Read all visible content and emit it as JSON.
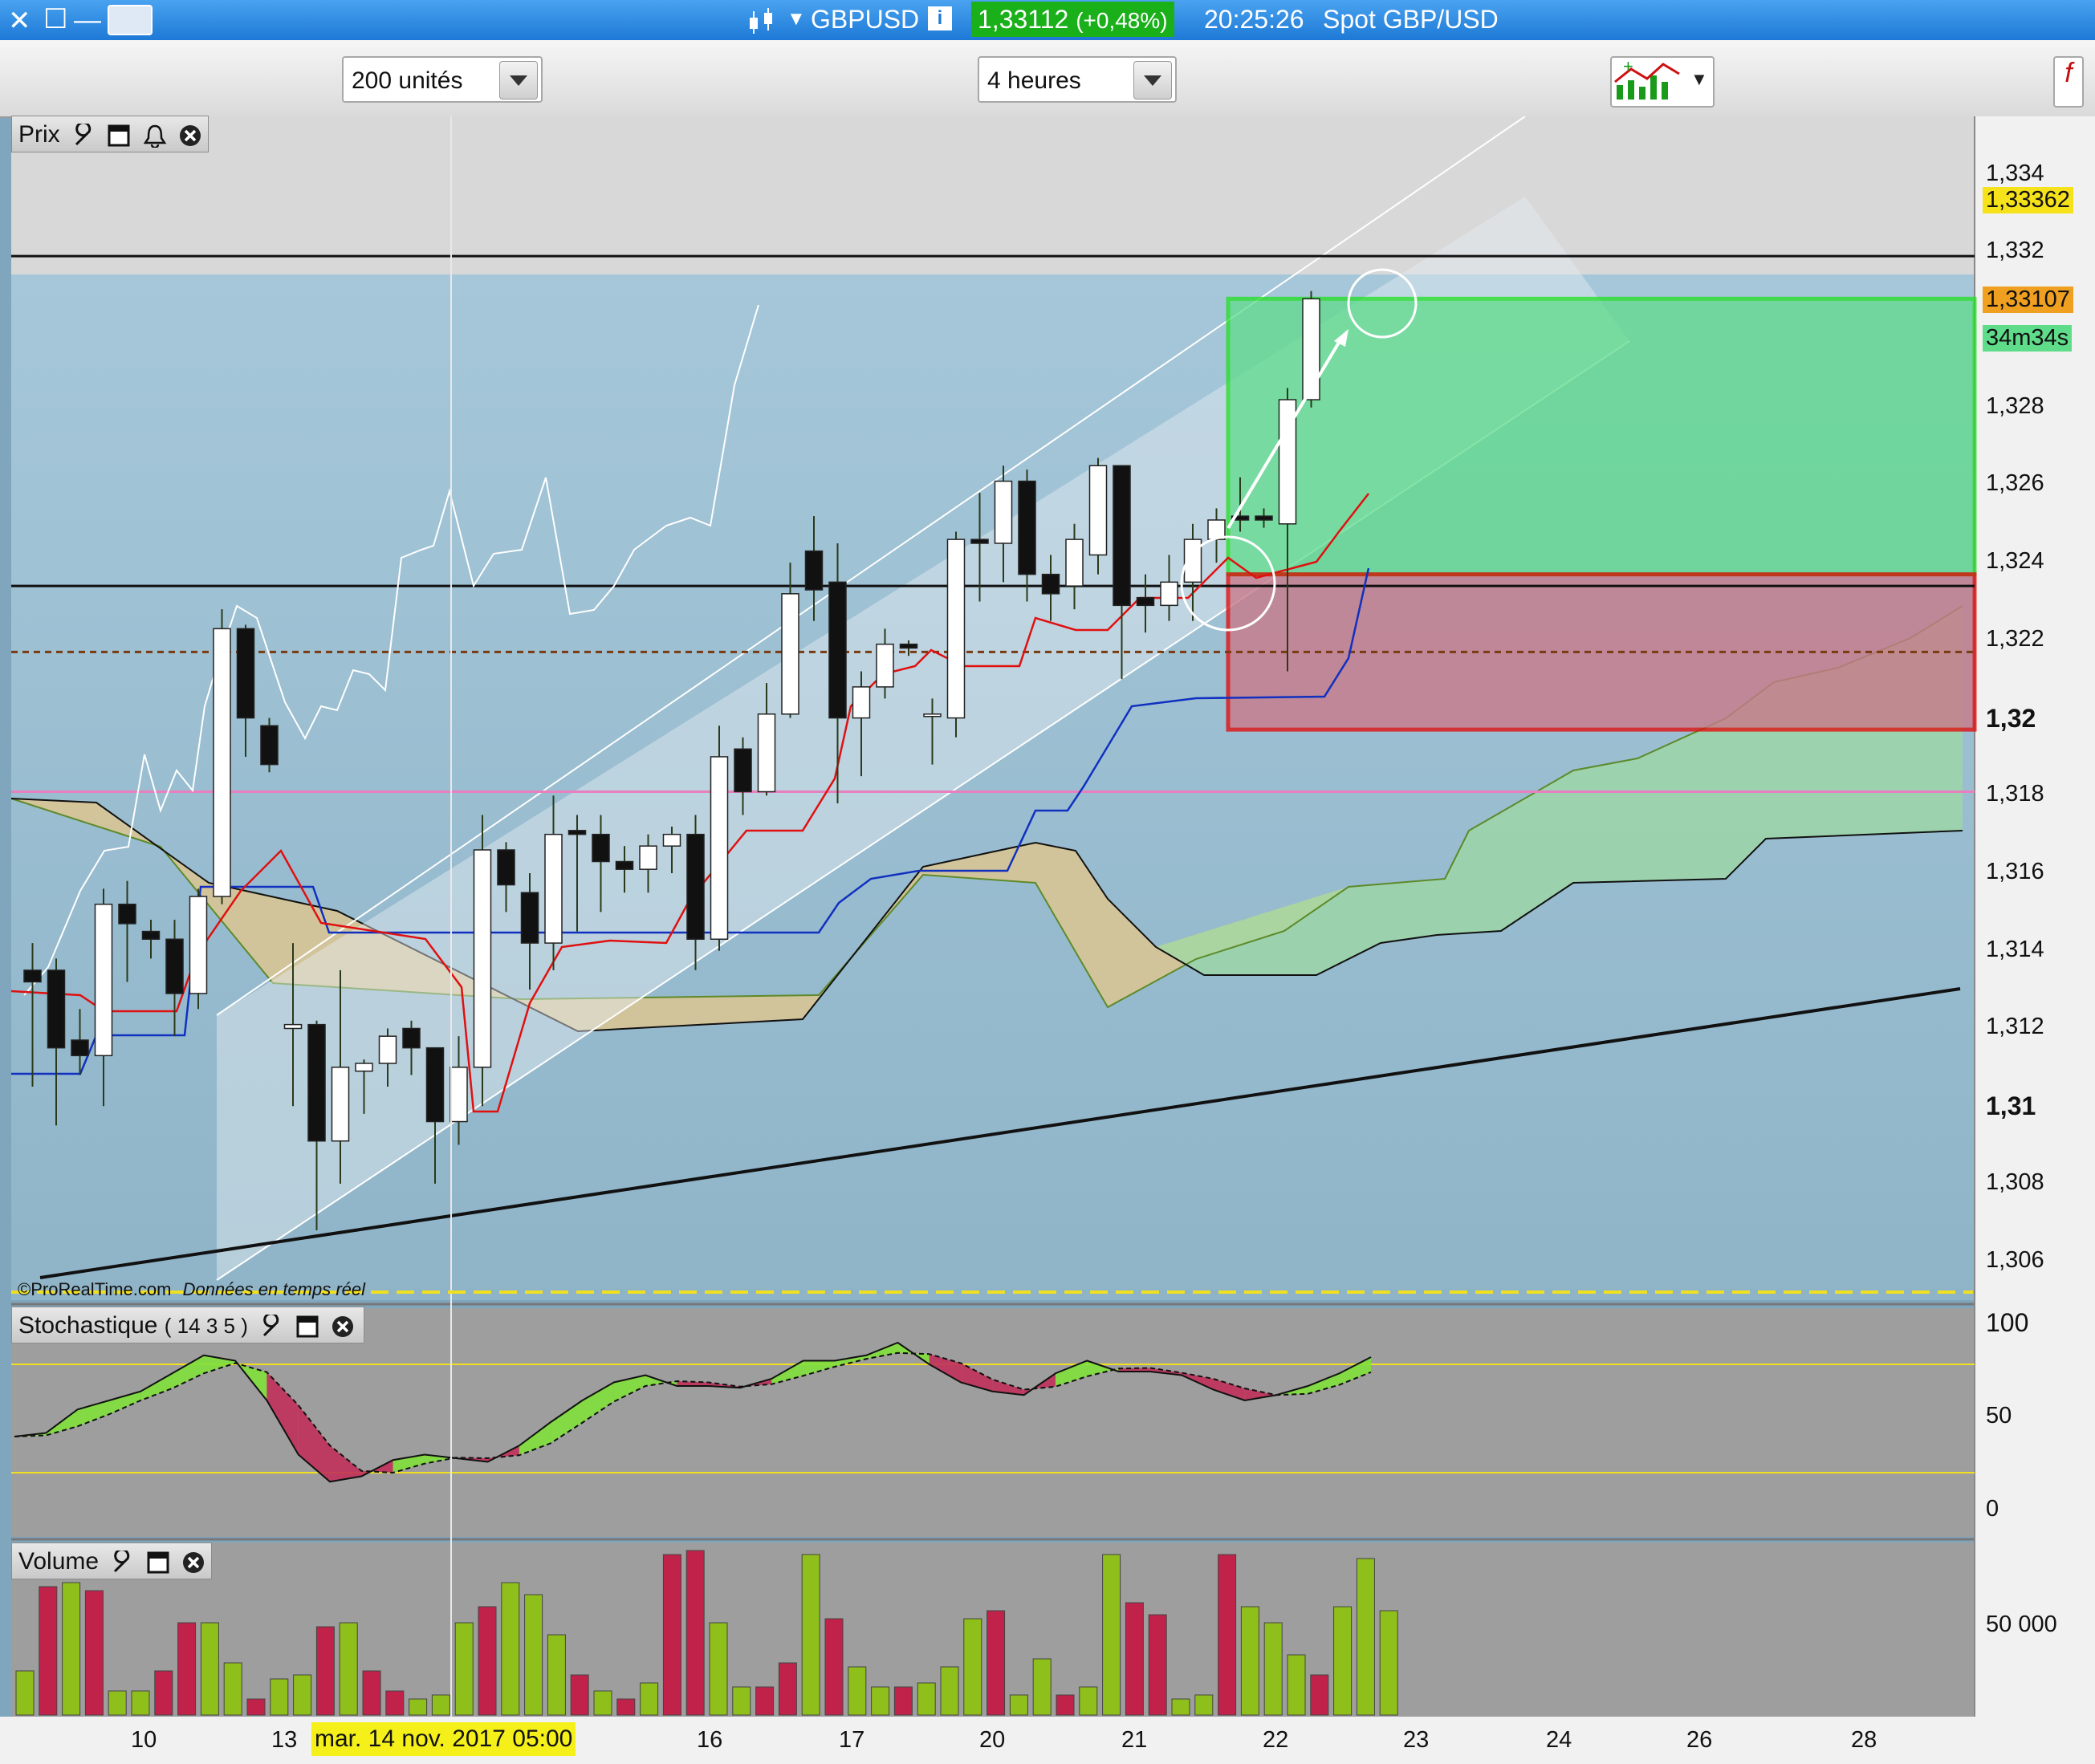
{
  "window": {
    "symbol": "GBPUSD",
    "price": "1,33112",
    "change": "(+0,48%)",
    "time": "20:25:26",
    "description": "Spot GBP/USD"
  },
  "toolbar": {
    "units_value": "200 unités",
    "timeframe_value": "4 heures"
  },
  "price_panel": {
    "title": "Prix",
    "watermark_brand": "©ProRealTime.com",
    "watermark_note": "Données en temps réel",
    "y_ticks": [
      "1,334",
      "1,332",
      "1,328",
      "1,326",
      "1,324",
      "1,322",
      "1,32",
      "1,318",
      "1,316",
      "1,314",
      "1,312",
      "1,31",
      "1,308",
      "1,306"
    ],
    "badge_high": "1,33362",
    "badge_price": "1,33107",
    "badge_timer": "34m34s"
  },
  "stochastic_panel": {
    "title": "Stochastique",
    "params": "( 14 3 5 )",
    "y_ticks": [
      "100",
      "50",
      "0"
    ]
  },
  "volume_panel": {
    "title": "Volume",
    "y_ticks": [
      "50 000"
    ]
  },
  "x_axis": {
    "ticks": [
      "10",
      "13",
      "16",
      "17",
      "20",
      "21",
      "22",
      "23",
      "24",
      "26",
      "28"
    ],
    "cursor_label": "mar. 14 nov. 2017 05:00"
  },
  "colors": {
    "up": "#ffffff",
    "down": "#111111",
    "target_zone": "#5fdc8a",
    "stop_zone": "#c87a8a",
    "tenkan": "#e01010",
    "kijun": "#1030c0",
    "vol_up": "#8fbf1a",
    "vol_down": "#c0224a"
  },
  "chart_data": {
    "type": "candlestick",
    "symbol": "GBPUSD",
    "timeframe": "4 heures",
    "ylim": [
      1.305,
      1.3355
    ],
    "candles": [
      [
        1.3135,
        1.3132,
        1.3142,
        1.3105
      ],
      [
        1.3135,
        1.3115,
        1.3138,
        1.3095
      ],
      [
        1.3117,
        1.3113,
        1.3125,
        1.3108
      ],
      [
        1.3113,
        1.3152,
        1.3156,
        1.31
      ],
      [
        1.3152,
        1.3147,
        1.3158,
        1.3132
      ],
      [
        1.3145,
        1.3143,
        1.3148,
        1.3138
      ],
      [
        1.3143,
        1.3129,
        1.3148,
        1.3118
      ],
      [
        1.3129,
        1.3154,
        1.3156,
        1.3125
      ],
      [
        1.3154,
        1.3223,
        1.3228,
        1.3152
      ],
      [
        1.3223,
        1.32,
        1.3224,
        1.319
      ],
      [
        1.3198,
        1.3188,
        1.32,
        1.3186
      ],
      [
        1.312,
        1.3121,
        1.3142,
        1.31
      ],
      [
        1.3121,
        1.3091,
        1.3122,
        1.3068
      ],
      [
        1.3091,
        1.311,
        1.3135,
        1.308
      ],
      [
        1.3109,
        1.3111,
        1.3112,
        1.3098
      ],
      [
        1.3111,
        1.3118,
        1.312,
        1.3105
      ],
      [
        1.312,
        1.3115,
        1.3122,
        1.3108
      ],
      [
        1.3115,
        1.3096,
        1.3115,
        1.308
      ],
      [
        1.3096,
        1.311,
        1.3118,
        1.309
      ],
      [
        1.311,
        1.3166,
        1.3175,
        1.31
      ],
      [
        1.3166,
        1.3157,
        1.3168,
        1.315
      ],
      [
        1.3155,
        1.3142,
        1.316,
        1.313
      ],
      [
        1.3142,
        1.317,
        1.318,
        1.3135
      ],
      [
        1.3171,
        1.317,
        1.3175,
        1.3145
      ],
      [
        1.317,
        1.3163,
        1.3175,
        1.315
      ],
      [
        1.3163,
        1.3161,
        1.3167,
        1.3155
      ],
      [
        1.3161,
        1.3167,
        1.317,
        1.3155
      ],
      [
        1.3167,
        1.317,
        1.3172,
        1.316
      ],
      [
        1.317,
        1.3143,
        1.3175,
        1.3135
      ],
      [
        1.3143,
        1.319,
        1.3198,
        1.314
      ],
      [
        1.3192,
        1.3181,
        1.3195,
        1.3175
      ],
      [
        1.3181,
        1.3201,
        1.3209,
        1.318
      ],
      [
        1.3201,
        1.3232,
        1.324,
        1.32
      ],
      [
        1.3243,
        1.3233,
        1.3252,
        1.3225
      ],
      [
        1.3235,
        1.32,
        1.3245,
        1.3178
      ],
      [
        1.32,
        1.3208,
        1.3212,
        1.3185
      ],
      [
        1.3208,
        1.3219,
        1.3223,
        1.3205
      ],
      [
        1.3219,
        1.3218,
        1.322,
        1.3216
      ],
      [
        1.3201,
        1.3201,
        1.3205,
        1.3188
      ],
      [
        1.32,
        1.3246,
        1.3248,
        1.3195
      ],
      [
        1.3246,
        1.3245,
        1.3258,
        1.323
      ],
      [
        1.3245,
        1.3261,
        1.3265,
        1.3235
      ],
      [
        1.3261,
        1.3237,
        1.3264,
        1.323
      ],
      [
        1.3237,
        1.3232,
        1.3242,
        1.3225
      ],
      [
        1.3234,
        1.3246,
        1.325,
        1.3228
      ],
      [
        1.3242,
        1.3265,
        1.3267,
        1.3237
      ],
      [
        1.3265,
        1.3229,
        1.3265,
        1.321
      ],
      [
        1.3231,
        1.3229,
        1.3237,
        1.3222
      ],
      [
        1.3229,
        1.3235,
        1.3242,
        1.3225
      ],
      [
        1.3235,
        1.3246,
        1.325,
        1.3225
      ],
      [
        1.3246,
        1.3251,
        1.3254,
        1.324
      ],
      [
        1.3252,
        1.3251,
        1.3262,
        1.3248
      ],
      [
        1.3252,
        1.3251,
        1.3254,
        1.3249
      ],
      [
        1.325,
        1.3282,
        1.3285,
        1.3212
      ],
      [
        1.3282,
        1.3308,
        1.331,
        1.328
      ]
    ],
    "support_line": 1.3234,
    "resistance_line": 1.3319,
    "dotted_level": 1.3217,
    "pink_level": 1.3181,
    "target_zone": [
      1.3237,
      1.3308
    ],
    "stop_zone": [
      1.3197,
      1.3237
    ],
    "stochastic_k": [
      40,
      42,
      55,
      60,
      65,
      75,
      85,
      82,
      60,
      30,
      15,
      18,
      27,
      30,
      28,
      26,
      35,
      48,
      60,
      70,
      74,
      68,
      68,
      67,
      72,
      82,
      82,
      85,
      92,
      80,
      70,
      65,
      63,
      75,
      82,
      76,
      76,
      74,
      66,
      60,
      63,
      68,
      75,
      84
    ],
    "volume": [
      [
        0,
        1
      ],
      [
        1,
        1
      ],
      [
        0,
        1
      ],
      [
        1,
        1
      ],
      [
        0,
        1
      ],
      [
        0,
        1
      ],
      [
        1,
        0
      ],
      [
        1,
        0
      ],
      [
        0,
        1
      ],
      [
        1,
        1
      ],
      [
        0,
        1
      ],
      [
        0,
        1
      ],
      [
        0,
        1
      ],
      [
        0,
        1
      ],
      [
        1,
        0
      ],
      [
        0,
        1
      ],
      [
        1,
        0
      ],
      [
        1,
        0
      ],
      [
        0,
        1
      ],
      [
        1,
        1
      ]
    ]
  }
}
